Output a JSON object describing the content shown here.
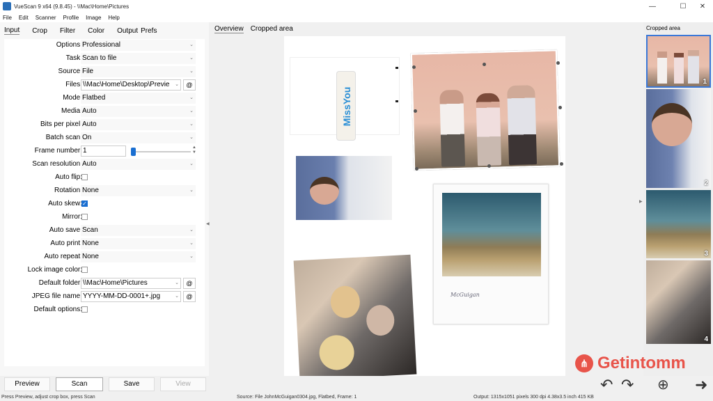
{
  "window": {
    "title": "VueScan 9 x64 (9.8.45) - \\\\Mac\\Home\\Pictures"
  },
  "menu": [
    "File",
    "Edit",
    "Scanner",
    "Profile",
    "Image",
    "Help"
  ],
  "left_tabs": [
    "Input",
    "Crop",
    "Filter",
    "Color",
    "Output",
    "Prefs"
  ],
  "form": {
    "options": {
      "label": "Options:",
      "value": "Professional"
    },
    "task": {
      "label": "Task:",
      "value": "Scan to file"
    },
    "source": {
      "label": "Source:",
      "value": "File"
    },
    "files": {
      "label": "Files:",
      "value": "\\\\Mac\\Home\\Desktop\\Previe"
    },
    "mode": {
      "label": "Mode:",
      "value": "Flatbed"
    },
    "media": {
      "label": "Media:",
      "value": "Auto"
    },
    "bits": {
      "label": "Bits per pixel:",
      "value": "Auto"
    },
    "batch": {
      "label": "Batch scan:",
      "value": "On"
    },
    "frame": {
      "label": "Frame number:",
      "value": "1"
    },
    "resolution": {
      "label": "Scan resolution:",
      "value": "Auto"
    },
    "autoflip": {
      "label": "Auto flip:",
      "checked": false
    },
    "rotation": {
      "label": "Rotation:",
      "value": "None"
    },
    "autoskew": {
      "label": "Auto skew:",
      "checked": true
    },
    "mirror": {
      "label": "Mirror:",
      "checked": false
    },
    "autosave": {
      "label": "Auto save:",
      "value": "Scan"
    },
    "autoprint": {
      "label": "Auto print:",
      "value": "None"
    },
    "autorepeat": {
      "label": "Auto repeat:",
      "value": "None"
    },
    "lockcolor": {
      "label": "Lock image color:",
      "checked": false
    },
    "folder": {
      "label": "Default folder:",
      "value": "\\\\Mac\\Home\\Pictures"
    },
    "jpeg": {
      "label": "JPEG file name:",
      "value": "YYYY-MM-DD-0001+.jpg"
    },
    "defaultopts": {
      "label": "Default options:",
      "checked": false
    },
    "at_label": "@"
  },
  "buttons": {
    "preview": "Preview",
    "scan": "Scan",
    "save": "Save",
    "view": "View"
  },
  "center_tabs": [
    "Overview",
    "Cropped area"
  ],
  "photo_text": "MissYou",
  "photo_caption": "McGuigan",
  "right_panel": {
    "title": "Cropped area",
    "thumbs": [
      "1",
      "2",
      "3",
      "4"
    ]
  },
  "status": {
    "left": "Press Preview, adjust crop box, press Scan",
    "middle": "Source: File JohnMcGuigan0304.jpg, Flatbed, Frame: 1",
    "right": "Output: 1315x1051 pixels 300 dpi 4.38x3.5 inch 415 KB"
  },
  "watermark": "Getintomm",
  "icons": {
    "undo": "undo-icon",
    "redo": "redo-icon",
    "zoom": "zoom-in-icon",
    "next": "arrow-right-icon"
  },
  "colors": {
    "accent": "#1a6fd1",
    "watermark": "#e8544a"
  }
}
